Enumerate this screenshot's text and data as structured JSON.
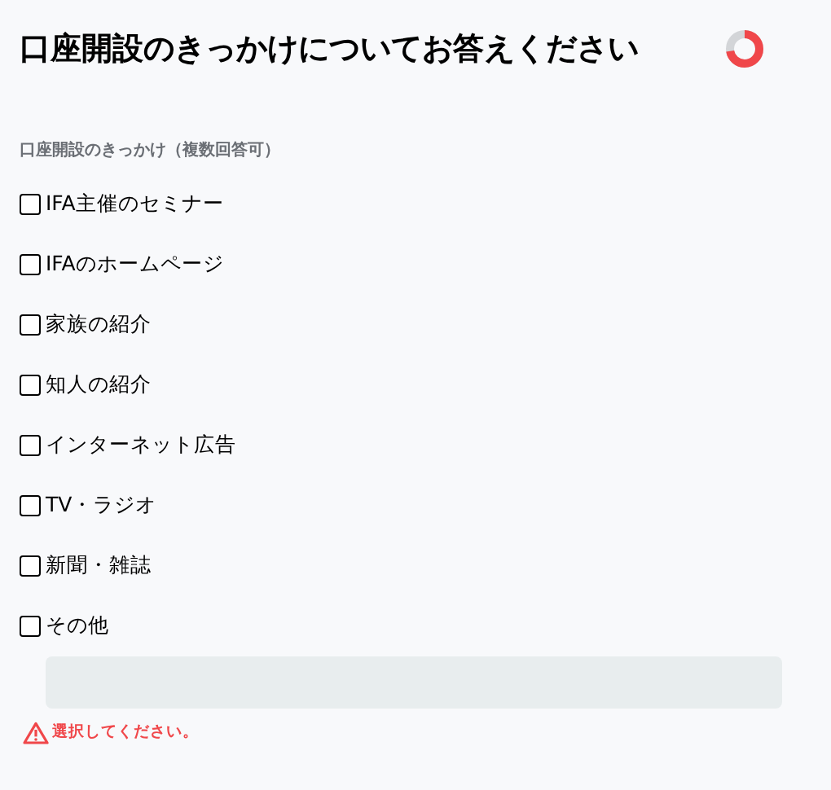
{
  "title": "口座開設のきっかけについてお答えください",
  "question": {
    "label": "口座開設のきっかけ（複数回答可）",
    "options": [
      {
        "label": "IFA主催のセミナー",
        "checked": false
      },
      {
        "label": "IFAのホームページ",
        "checked": false
      },
      {
        "label": "家族の紹介",
        "checked": false
      },
      {
        "label": "知人の紹介",
        "checked": false
      },
      {
        "label": "インターネット広告",
        "checked": false
      },
      {
        "label": "TV・ラジオ",
        "checked": false
      },
      {
        "label": "新聞・雑誌",
        "checked": false
      },
      {
        "label": "その他",
        "checked": false
      }
    ],
    "error": "選択してください。"
  }
}
